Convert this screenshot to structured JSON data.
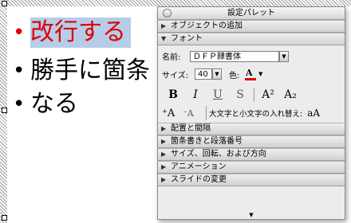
{
  "slide": {
    "bullets": [
      {
        "symbol": "•",
        "text": "改行する",
        "color": "#e00000",
        "selected": true
      },
      {
        "symbol": "•",
        "text": "勝手に箇条",
        "color": "#000000",
        "selected": false
      },
      {
        "symbol": "•",
        "text": "なる",
        "color": "#000000",
        "selected": false
      }
    ]
  },
  "palette": {
    "title": "設定パレット",
    "sections_top": {
      "add_object": "オブジェクトの追加",
      "font": "フォント"
    },
    "font": {
      "name_label": "名前:",
      "name_value": "ＤＦＰ隷書体",
      "size_label": "サイズ:",
      "size_value": "40",
      "color_label": "色:",
      "color_value": "#e00000",
      "format_buttons": [
        "B",
        "I",
        "U",
        "S",
        "A²",
        "A₂"
      ],
      "case_label": "大文字と小文字の入れ替え:",
      "case_sample": "aA"
    },
    "sections_bottom": [
      "配置と間隔",
      "箇条書きと段落番号",
      "サイズ、回転、および方向",
      "アニメーション",
      "スライドの変更"
    ]
  }
}
